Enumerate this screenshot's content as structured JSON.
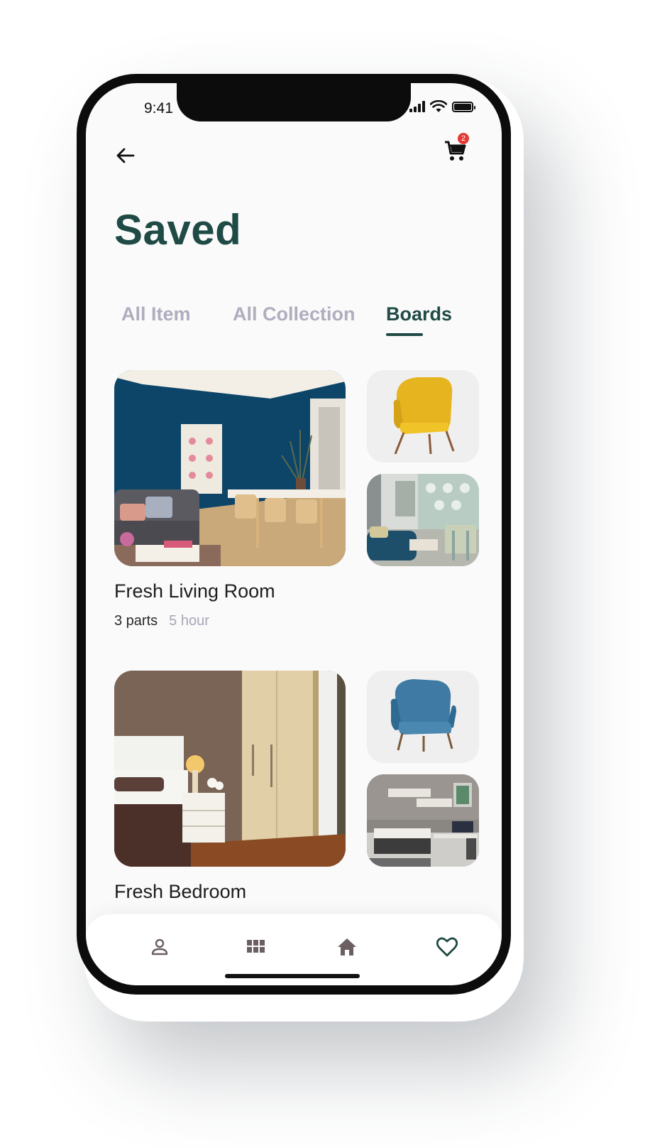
{
  "status_bar": {
    "time": "9:41"
  },
  "header": {
    "back_icon": "arrow-left-icon",
    "cart_icon": "cart-icon",
    "cart_badge": "2"
  },
  "page": {
    "title": "Saved"
  },
  "tabs": [
    {
      "label": "All Item",
      "active": false
    },
    {
      "label": "All Collection",
      "active": false
    },
    {
      "label": "Boards",
      "active": true
    }
  ],
  "boards": [
    {
      "name": "Fresh Living Room",
      "parts": "3 parts",
      "time": "5 hour",
      "main_image": "living-room-photo",
      "thumb_images": [
        "yellow-armchair-photo",
        "teal-sofa-room-photo"
      ]
    },
    {
      "name": "Fresh Bedroom",
      "main_image": "bedroom-photo",
      "thumb_images": [
        "blue-armchair-photo",
        "kids-room-photo"
      ]
    }
  ],
  "bottom_nav": [
    {
      "icon": "profile-icon",
      "active": false
    },
    {
      "icon": "grid-icon",
      "active": false
    },
    {
      "icon": "home-icon",
      "active": false
    },
    {
      "icon": "heart-icon",
      "active": true
    }
  ],
  "colors": {
    "accent": "#1f4a45",
    "tab_inactive": "#b0adbf",
    "badge": "#e53935",
    "meta_muted": "#a8a5b8"
  }
}
